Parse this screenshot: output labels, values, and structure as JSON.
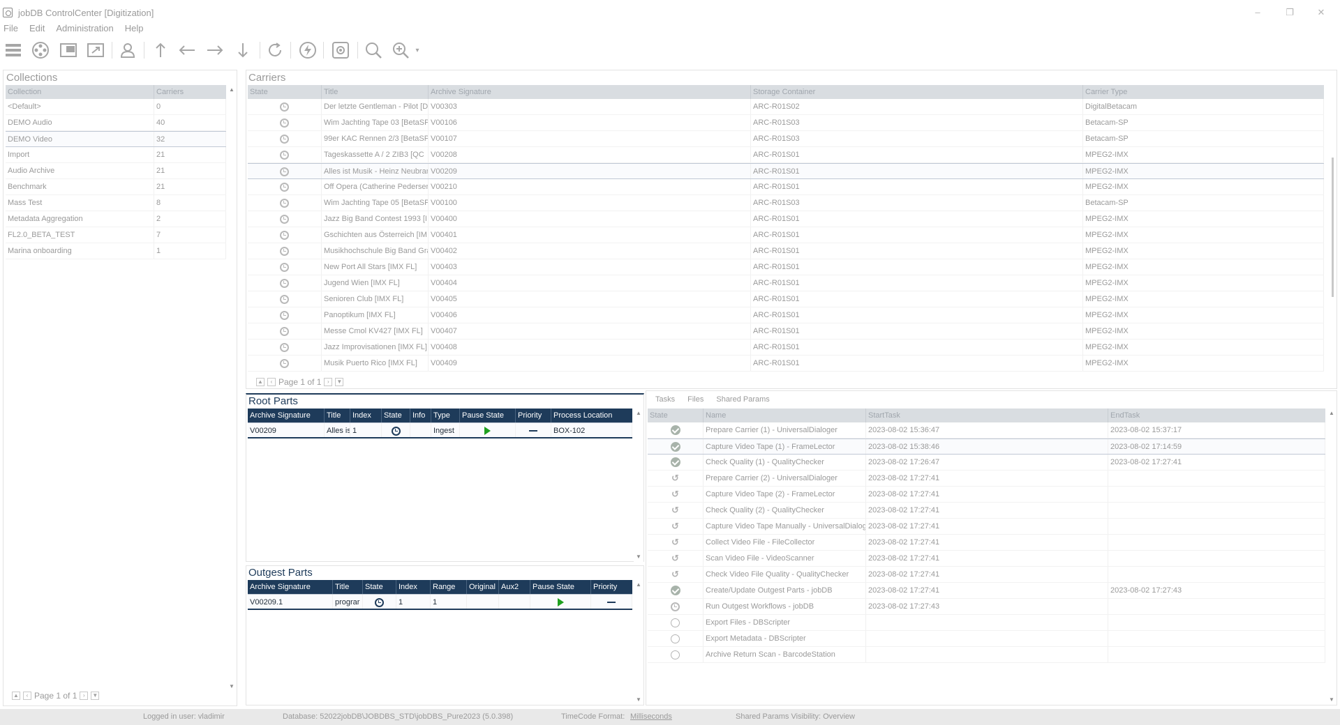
{
  "window": {
    "title": "jobDB ControlCenter [Digitization]",
    "controls": [
      "–",
      "❐",
      "✕"
    ]
  },
  "menu": [
    "File",
    "Edit",
    "Administration",
    "Help"
  ],
  "collections": {
    "title": "Collections",
    "headers": [
      "Collection",
      "Carriers"
    ],
    "rows": [
      {
        "name": "<Default>",
        "carriers": "0"
      },
      {
        "name": "DEMO Audio",
        "carriers": "40"
      },
      {
        "name": "DEMO Video",
        "carriers": "32"
      },
      {
        "name": "Import",
        "carriers": "21"
      },
      {
        "name": "Audio Archive",
        "carriers": "21"
      },
      {
        "name": "Benchmark",
        "carriers": "21"
      },
      {
        "name": "Mass Test",
        "carriers": "8"
      },
      {
        "name": "Metadata Aggregation",
        "carriers": "2"
      },
      {
        "name": "FL2.0_BETA_TEST",
        "carriers": "7"
      },
      {
        "name": "Marina onboarding",
        "carriers": "1"
      }
    ],
    "pager": "Page 1 of 1"
  },
  "carriers": {
    "title": "Carriers",
    "headers": [
      "State",
      "Title",
      "Archive Signature",
      "Storage Container",
      "Carrier Type"
    ],
    "rows": [
      {
        "title": "Der letzte Gentleman - Pilot [Di",
        "sig": "V00303",
        "container": "ARC-R01S02",
        "type": "DigitalBetacam"
      },
      {
        "title": "Wim Jachting Tape 03 [BetaSP",
        "sig": "V00106",
        "container": "ARC-R01S03",
        "type": "Betacam-SP"
      },
      {
        "title": "99er KAC Rennen 2/3 [BetaSP",
        "sig": "V00107",
        "container": "ARC-R01S03",
        "type": "Betacam-SP"
      },
      {
        "title": " Tageskassette A / 2  ZIB3 [QC",
        "sig": "V00208",
        "container": "ARC-R01S01",
        "type": "MPEG2-IMX"
      },
      {
        "title": "Alles ist Musik - Heinz Neubranc",
        "sig": "V00209",
        "container": "ARC-R01S01",
        "type": "MPEG2-IMX"
      },
      {
        "title": "Off Opera (Catherine Pedersen",
        "sig": "V00210",
        "container": "ARC-R01S01",
        "type": "MPEG2-IMX"
      },
      {
        "title": "Wim Jachting Tape 05 [BetaSP",
        "sig": "V00100",
        "container": "ARC-R01S03",
        "type": "Betacam-SP"
      },
      {
        "title": "Jazz Big Band Contest 1993 [I",
        "sig": "V00400",
        "container": "ARC-R01S01",
        "type": "MPEG2-IMX"
      },
      {
        "title": "Gschichten aus Österreich [IM",
        "sig": "V00401",
        "container": "ARC-R01S01",
        "type": "MPEG2-IMX"
      },
      {
        "title": "Musikhochschule Big Band Graz",
        "sig": "V00402",
        "container": "ARC-R01S01",
        "type": "MPEG2-IMX"
      },
      {
        "title": "New Port All Stars [IMX FL]",
        "sig": "V00403",
        "container": "ARC-R01S01",
        "type": "MPEG2-IMX"
      },
      {
        "title": "Jugend Wien [IMX FL]",
        "sig": "V00404",
        "container": "ARC-R01S01",
        "type": "MPEG2-IMX"
      },
      {
        "title": "Senioren Club [IMX FL]",
        "sig": "V00405",
        "container": "ARC-R01S01",
        "type": "MPEG2-IMX"
      },
      {
        "title": "Panoptikum [IMX FL]",
        "sig": "V00406",
        "container": "ARC-R01S01",
        "type": "MPEG2-IMX"
      },
      {
        "title": "Messe Cmol KV427 [IMX FL]",
        "sig": "V00407",
        "container": "ARC-R01S01",
        "type": "MPEG2-IMX"
      },
      {
        "title": "Jazz Improvisationen [IMX FL]",
        "sig": "V00408",
        "container": "ARC-R01S01",
        "type": "MPEG2-IMX"
      },
      {
        "title": "Musik Puerto Rico [IMX FL]",
        "sig": "V00409",
        "container": "ARC-R01S01",
        "type": "MPEG2-IMX"
      }
    ],
    "pager": "Page 1 of 1"
  },
  "root_parts": {
    "title": "Root Parts",
    "headers": [
      "Archive Signature",
      "Title",
      "Index",
      "State",
      "Info",
      "Type",
      "Pause State",
      "Priority",
      "Process Location"
    ],
    "row": {
      "sig": "V00209",
      "title": "Alles is",
      "index": "1",
      "info": "",
      "type": "Ingest",
      "location": "BOX-102"
    }
  },
  "outgest_parts": {
    "title": "Outgest Parts",
    "headers": [
      "Archive Signature",
      "Title",
      "State",
      "Index",
      "Range",
      "Original",
      "Aux2",
      "Pause State",
      "Priority"
    ],
    "row": {
      "sig": "V00209.1",
      "title": "prograr",
      "index": "1",
      "range": "1",
      "original": "",
      "aux2": ""
    }
  },
  "tasks": {
    "tabs": [
      "Tasks",
      "Files",
      "Shared Params"
    ],
    "headers": [
      "State",
      "Name",
      "StartTask",
      "EndTask"
    ],
    "rows": [
      {
        "state": "done",
        "name": "Prepare Carrier (1) - UniversalDialoger",
        "start": "2023-08-02 15:36:47",
        "end": "2023-08-02 15:37:17"
      },
      {
        "state": "done",
        "name": "Capture Video Tape (1) - FrameLector",
        "start": "2023-08-02 15:38:46",
        "end": "2023-08-02 17:14:59"
      },
      {
        "state": "done",
        "name": "Check Quality (1) - QualityChecker",
        "start": "2023-08-02 17:26:47",
        "end": "2023-08-02 17:27:41"
      },
      {
        "state": "return",
        "name": "Prepare Carrier (2) - UniversalDialoger",
        "start": "2023-08-02 17:27:41",
        "end": ""
      },
      {
        "state": "return",
        "name": "Capture Video Tape (2) - FrameLector",
        "start": "2023-08-02 17:27:41",
        "end": ""
      },
      {
        "state": "return",
        "name": "Check Quality (2) - QualityChecker",
        "start": "2023-08-02 17:27:41",
        "end": ""
      },
      {
        "state": "return",
        "name": "Capture Video Tape Manually - UniversalDialoge",
        "start": "2023-08-02 17:27:41",
        "end": ""
      },
      {
        "state": "return",
        "name": "Collect Video File - FileCollector",
        "start": "2023-08-02 17:27:41",
        "end": ""
      },
      {
        "state": "return",
        "name": "Scan Video File - VideoScanner",
        "start": "2023-08-02 17:27:41",
        "end": ""
      },
      {
        "state": "return",
        "name": "Check Video File Quality - QualityChecker",
        "start": "2023-08-02 17:27:41",
        "end": ""
      },
      {
        "state": "done",
        "name": "Create/Update Outgest Parts - jobDB",
        "start": "2023-08-02 17:27:41",
        "end": "2023-08-02 17:27:43"
      },
      {
        "state": "running",
        "name": "Run Outgest Workflows - jobDB",
        "start": "2023-08-02 17:27:43",
        "end": ""
      },
      {
        "state": "empty",
        "name": "Export Files - DBScripter",
        "start": "",
        "end": ""
      },
      {
        "state": "empty",
        "name": "Export Metadata - DBScripter",
        "start": "",
        "end": ""
      },
      {
        "state": "empty",
        "name": "Archive Return Scan - BarcodeStation",
        "start": "",
        "end": ""
      }
    ]
  },
  "status": {
    "user": "Logged in user: vladimir",
    "database": "Database: 52022jobDB\\JOBDBS_STD\\jobDBS_Pure2023 (5.0.398)",
    "timecode_label": "TimeCode Format:",
    "timecode_value": "Milliseconds",
    "shared_params": "Shared Params Visibility: Overview"
  }
}
